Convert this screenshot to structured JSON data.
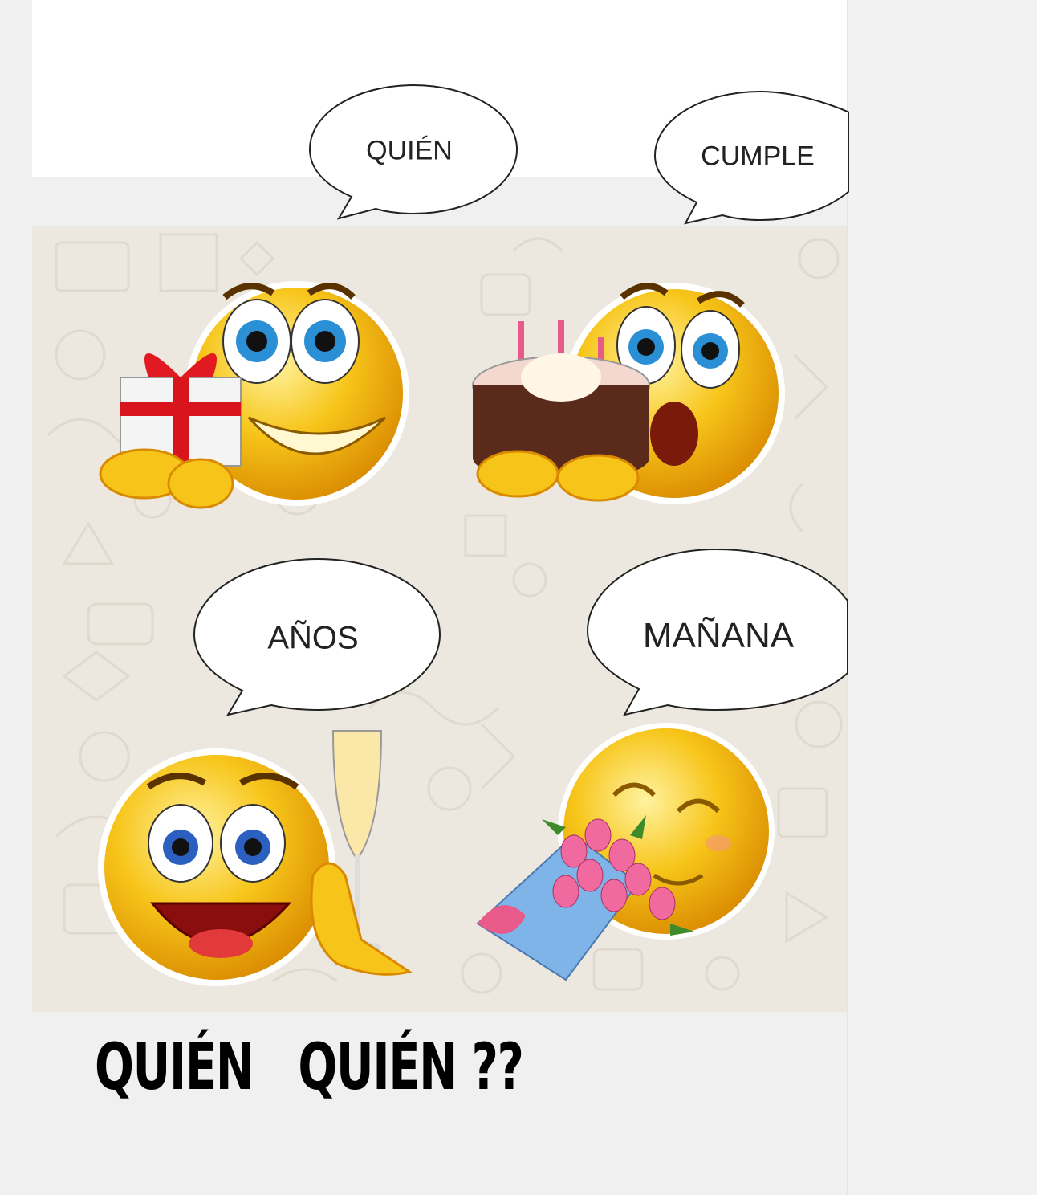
{
  "bubbles": {
    "b1": "QUIÉN",
    "b2": "CUMPLE",
    "b3": "AÑOS",
    "b4": "MAÑANA"
  },
  "caption": "QUIÉN   QUIÉN ??",
  "stickers": {
    "s1": "gift-emoji-icon",
    "s2": "cake-emoji-icon",
    "s3": "champagne-emoji-icon",
    "s4": "flowers-emoji-icon"
  },
  "colors": {
    "emoji_yellow": "#f7c51a",
    "chat_background": "#ece7df"
  }
}
